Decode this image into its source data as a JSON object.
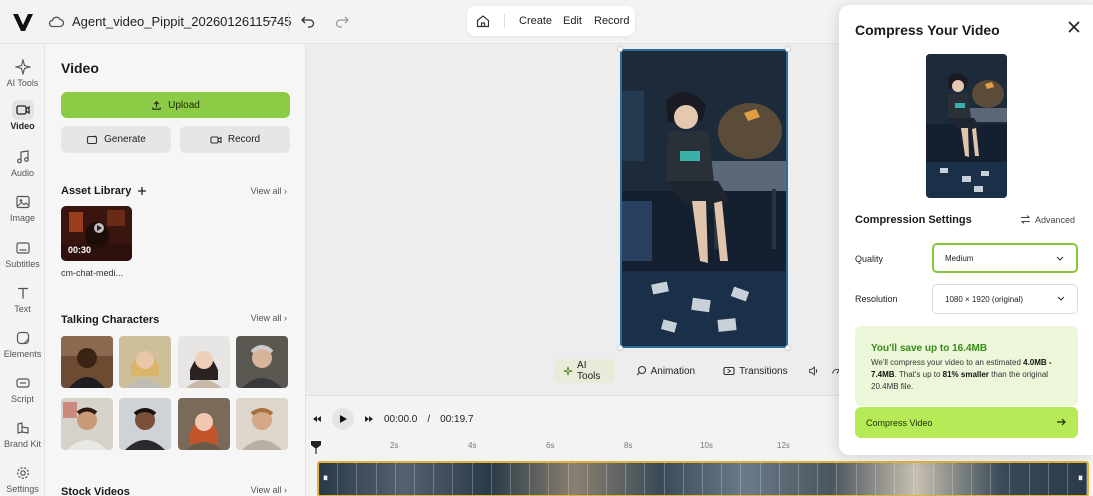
{
  "topbar": {
    "project_title": "Agent_video_Pippit_20260126115745",
    "more": "···",
    "modes": [
      "Create",
      "Edit",
      "Record"
    ]
  },
  "rail": [
    {
      "label": "AI Tools",
      "icon": "sparkle-icon"
    },
    {
      "label": "Video",
      "icon": "video-icon",
      "active": true
    },
    {
      "label": "Audio",
      "icon": "music-note-icon"
    },
    {
      "label": "Image",
      "icon": "image-icon"
    },
    {
      "label": "Subtitles",
      "icon": "subtitles-icon"
    },
    {
      "label": "Text",
      "icon": "text-icon"
    },
    {
      "label": "Elements",
      "icon": "elements-icon"
    },
    {
      "label": "Script",
      "icon": "script-icon"
    },
    {
      "label": "Brand Kit",
      "icon": "brand-kit-icon"
    },
    {
      "label": "Settings",
      "icon": "gear-icon"
    }
  ],
  "panel": {
    "title": "Video",
    "upload_label": "Upload",
    "generate_label": "Generate",
    "record_label": "Record",
    "asset_library": {
      "title": "Asset Library",
      "view_all": "View all",
      "items": [
        {
          "name": "cm-chat-medi...",
          "duration": "00:30"
        }
      ]
    },
    "talking_characters": {
      "title": "Talking Characters",
      "view_all": "View all"
    },
    "stock_videos": {
      "title": "Stock Videos",
      "view_all": "View all"
    }
  },
  "canvas_toolbar": {
    "ai_tools": "AI Tools",
    "animation": "Animation",
    "transitions": "Transitions"
  },
  "timeline": {
    "current_time": "00:00.0",
    "separator": "/",
    "total_time": "00:19.7",
    "ticks": [
      "2s",
      "4s",
      "6s",
      "8s",
      "10s",
      "12s"
    ]
  },
  "modal": {
    "title": "Compress Your Video",
    "settings_title": "Compression Settings",
    "advanced_label": "Advanced",
    "quality": {
      "label": "Quality",
      "value": "Medium"
    },
    "resolution": {
      "label": "Resolution",
      "value": "1080 × 1920 (original)"
    },
    "savings": {
      "headline": "You'll save up to 16.4MB",
      "line_prefix": "We'll compress your video to an estimated",
      "range": "4.0MB - 7.4MB",
      "mid": ". That's up to",
      "percent": "81% smaller",
      "suffix": "than the original 20.4MB file."
    },
    "button_label": "Compress Video"
  },
  "colors": {
    "accent_green": "#8bcb45",
    "compress_button": "#b6ea57",
    "savings_bg": "#ecf7da",
    "savings_headline": "#3a8a18",
    "timeline_track_border": "#e0b23a"
  }
}
